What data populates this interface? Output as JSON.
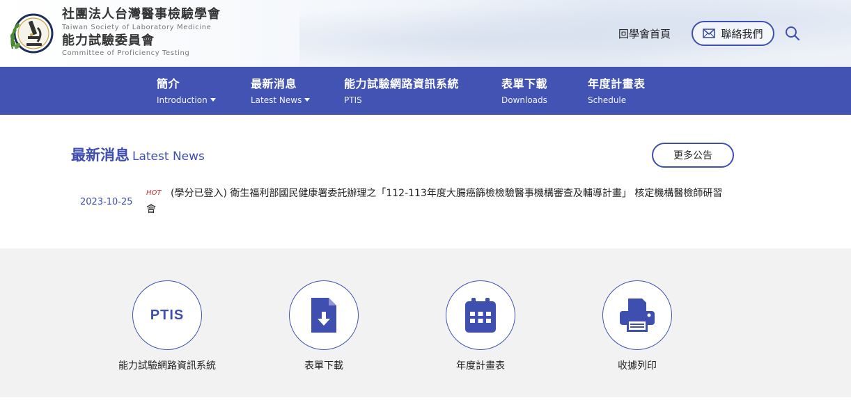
{
  "header": {
    "org_name_zh": "社團法人台灣醫事檢驗學會",
    "org_name_en": "Taiwan Society of Laboratory Medicine",
    "committee_zh": "能力試驗委員會",
    "committee_en": "Committee of Proficiency Testing",
    "logo_text": "Taiwan Society of Laboratory Medicine",
    "home_link": "回學會首頁",
    "contact_label": "聯絡我們",
    "contact_icon": "envelope-icon",
    "search_icon": "search-icon"
  },
  "nav": {
    "items": [
      {
        "zh": "簡介",
        "en": "Introduction",
        "dropdown": true
      },
      {
        "zh": "最新消息",
        "en": "Latest News",
        "dropdown": true
      },
      {
        "zh": "能力試驗網路資訊系統",
        "en": "PTIS",
        "dropdown": false
      },
      {
        "zh": "表單下載",
        "en": "Downloads",
        "dropdown": false
      },
      {
        "zh": "年度計畫表",
        "en": "Schedule",
        "dropdown": false
      }
    ]
  },
  "news": {
    "title_zh": "最新消息",
    "title_en": "Latest News",
    "more_label": "更多公告",
    "items": [
      {
        "date": "2023-10-25",
        "badge": "HOT",
        "text": "(學分已登入) 衛生福利部國民健康署委託辦理之「112-113年度大腸癌篩檢檢驗醫事機構審查及輔導計畫」 核定機構醫檢師研習會"
      }
    ]
  },
  "quick_links": [
    {
      "icon_text": "PTIS",
      "label": "能力試驗網路資訊系統"
    },
    {
      "icon": "file-download-icon",
      "label": "表單下載"
    },
    {
      "icon": "calendar-icon",
      "label": "年度計畫表"
    },
    {
      "icon": "printer-icon",
      "label": "收據列印"
    }
  ],
  "colors": {
    "brand": "#4253b4",
    "accent_text": "#3f4fb0",
    "hot": "#d63030",
    "quick_bg": "#f2f2f2"
  }
}
